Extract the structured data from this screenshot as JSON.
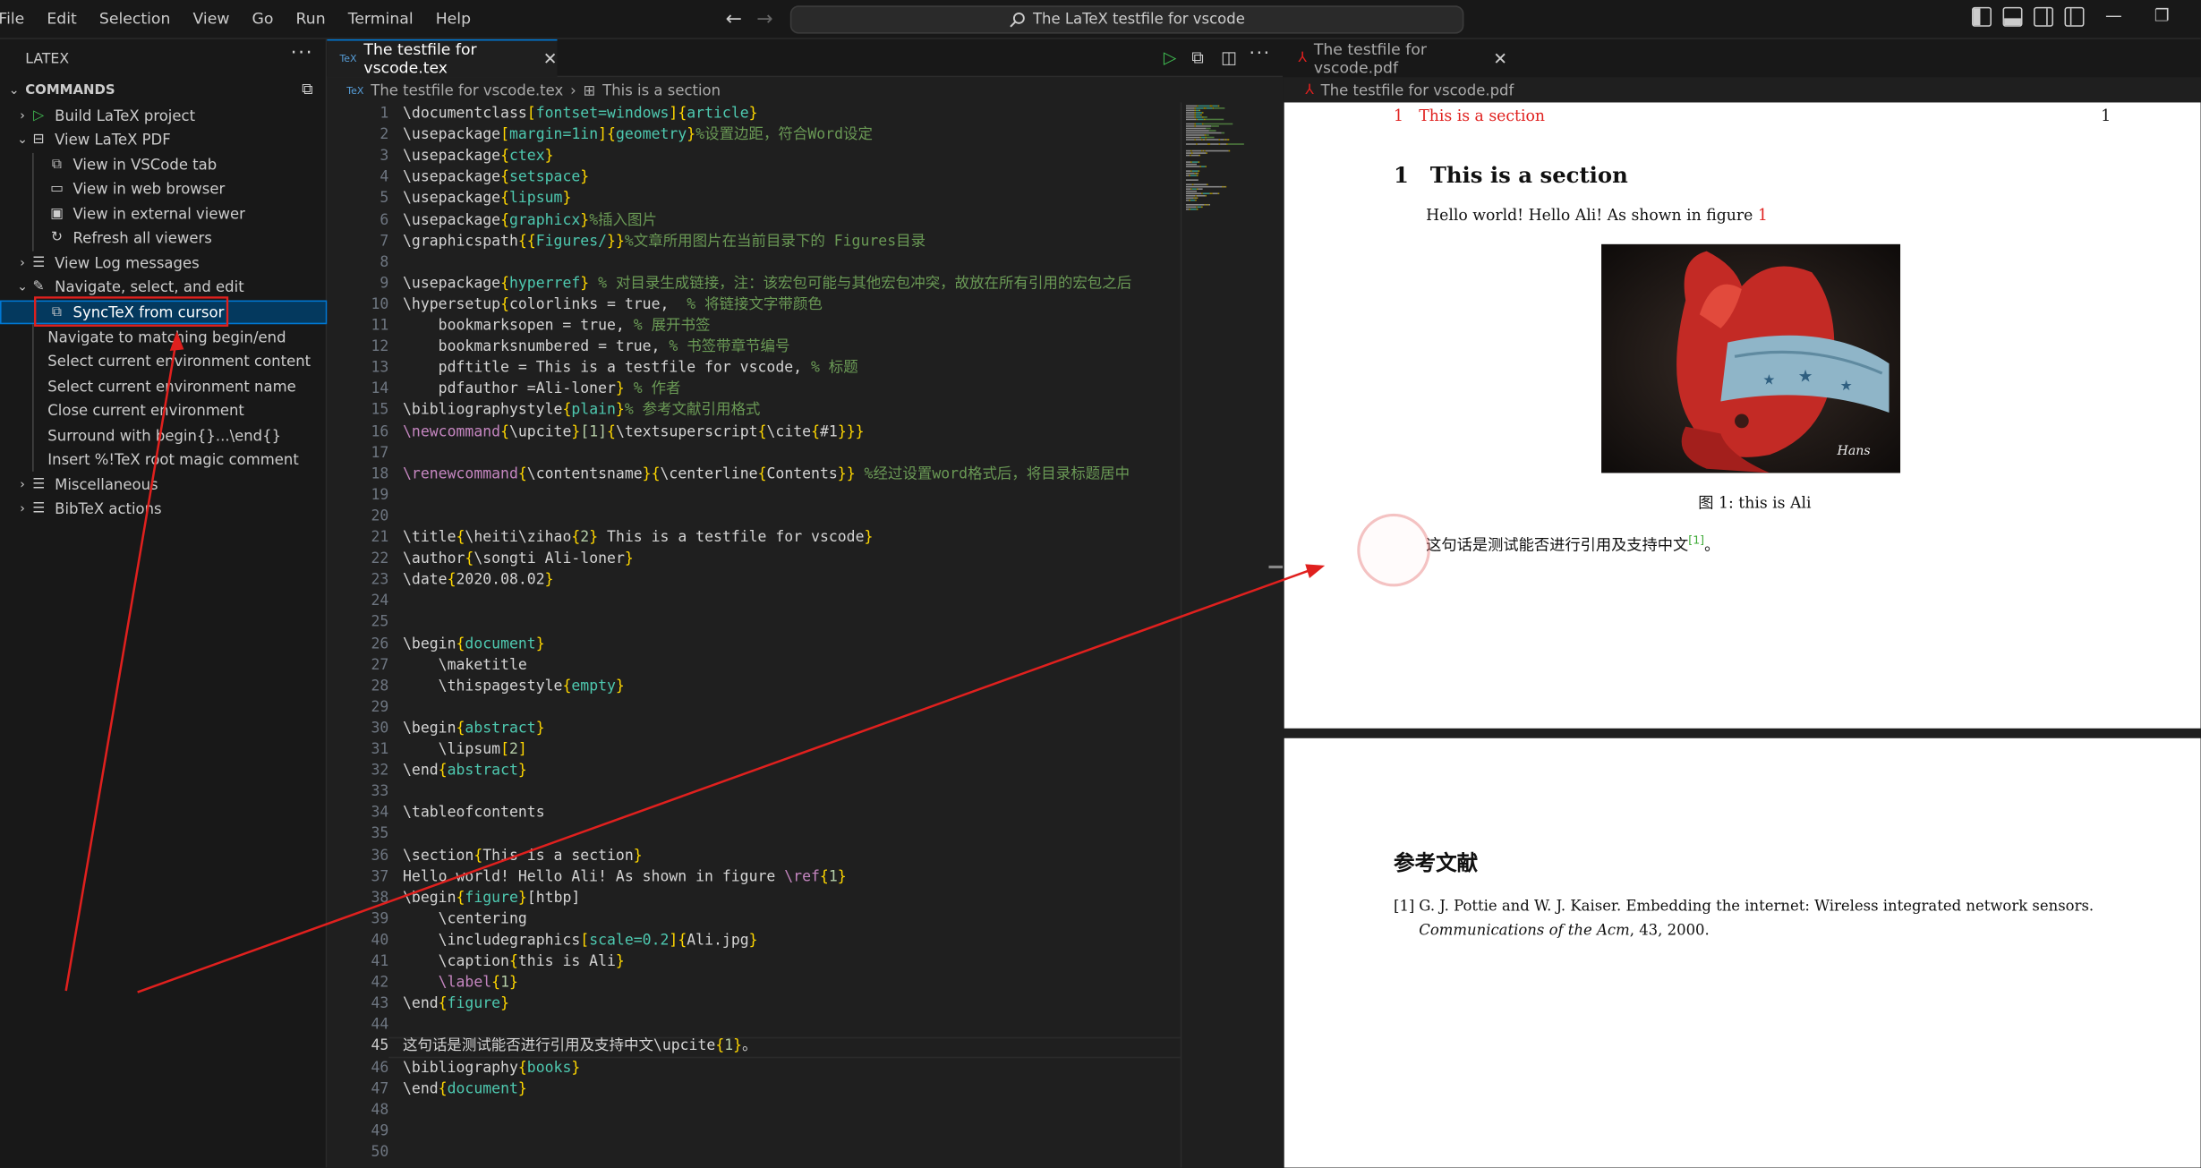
{
  "menubar": {
    "items": [
      "File",
      "Edit",
      "Selection",
      "View",
      "Go",
      "Run",
      "Terminal",
      "Help"
    ]
  },
  "command_center": {
    "label": "The LaTeX testfile for vscode"
  },
  "sidebar": {
    "title": "LATEX",
    "section": "COMMANDS",
    "items": [
      {
        "label": "Build LaTeX project",
        "icon": "play-icon"
      },
      {
        "label": "View LaTeX PDF",
        "icon": "preview-icon"
      },
      {
        "label": "View in VSCode tab",
        "icon": "open-preview-icon"
      },
      {
        "label": "View in web browser",
        "icon": "browser-icon"
      },
      {
        "label": "View in external viewer",
        "icon": "external-icon"
      },
      {
        "label": "Refresh all viewers",
        "icon": "refresh-icon"
      },
      {
        "label": "View Log messages",
        "icon": "output-icon"
      },
      {
        "label": "Navigate, select, and edit",
        "icon": "edit-icon"
      },
      {
        "label": "SyncTeX from cursor",
        "icon": "sync-icon"
      },
      {
        "label": "Navigate to matching begin/end"
      },
      {
        "label": "Select current environment content"
      },
      {
        "label": "Select current environment name"
      },
      {
        "label": "Close current environment"
      },
      {
        "label": "Surround with begin{}...\\end{}"
      },
      {
        "label": "Insert %!TeX root magic comment"
      },
      {
        "label": "Miscellaneous",
        "icon": "list-icon"
      },
      {
        "label": "BibTeX actions",
        "icon": "list-icon"
      }
    ]
  },
  "editor": {
    "tab": "The testfile for vscode.tex",
    "tab_prefix": "TeX",
    "breadcrumb_file": "The testfile for vscode.tex",
    "breadcrumb_symbol": "This is a section",
    "current_line": 45,
    "lines": [
      [
        [
          "\\documentclass",
          "kw"
        ],
        [
          "[",
          "br"
        ],
        [
          "fontset=windows",
          "ar"
        ],
        [
          "]",
          "br"
        ],
        [
          "{",
          "br"
        ],
        [
          "article",
          "ar"
        ],
        [
          "}",
          "br"
        ]
      ],
      [
        [
          "\\usepackage",
          "kw"
        ],
        [
          "[",
          "br"
        ],
        [
          "margin=1in",
          "ar"
        ],
        [
          "]",
          "br"
        ],
        [
          "{",
          "br"
        ],
        [
          "geometry",
          "ar"
        ],
        [
          "}",
          "br"
        ],
        [
          "%设置边距，符合Word设定",
          "cm"
        ]
      ],
      [
        [
          "\\usepackage",
          "kw"
        ],
        [
          "{",
          "br"
        ],
        [
          "ctex",
          "ar"
        ],
        [
          "}",
          "br"
        ]
      ],
      [
        [
          "\\usepackage",
          "kw"
        ],
        [
          "{",
          "br"
        ],
        [
          "setspace",
          "ar"
        ],
        [
          "}",
          "br"
        ]
      ],
      [
        [
          "\\usepackage",
          "kw"
        ],
        [
          "{",
          "br"
        ],
        [
          "lipsum",
          "ar"
        ],
        [
          "}",
          "br"
        ]
      ],
      [
        [
          "\\usepackage",
          "kw"
        ],
        [
          "{",
          "br"
        ],
        [
          "graphicx",
          "ar"
        ],
        [
          "}",
          "br"
        ],
        [
          "%插入图片",
          "cm"
        ]
      ],
      [
        [
          "\\graphicspath",
          "kw"
        ],
        [
          "{{",
          "br"
        ],
        [
          "Figures/",
          "ar"
        ],
        [
          "}}",
          "br"
        ],
        [
          "%文章所用图片在当前目录下的 Figures目录",
          "cm"
        ]
      ],
      [],
      [
        [
          "\\usepackage",
          "kw"
        ],
        [
          "{",
          "br"
        ],
        [
          "hyperref",
          "ar"
        ],
        [
          "}",
          "br"
        ],
        [
          " % 对目录生成链接，注：该宏包可能与其他宏包冲突，故放在所有引用的宏包之后",
          "cm"
        ]
      ],
      [
        [
          "\\hypersetup",
          "kw"
        ],
        [
          "{",
          "br"
        ],
        [
          "colorlinks = true,  ",
          "kw"
        ],
        [
          "% 将链接文字带颜色",
          "cm"
        ]
      ],
      [
        [
          "    bookmarksopen = true, ",
          "kw"
        ],
        [
          "% 展开书签",
          "cm"
        ]
      ],
      [
        [
          "    bookmarksnumbered = true, ",
          "kw"
        ],
        [
          "% 书签带章节编号",
          "cm"
        ]
      ],
      [
        [
          "    pdftitle = This is a testfile for vscode, ",
          "kw"
        ],
        [
          "% 标题",
          "cm"
        ]
      ],
      [
        [
          "    pdfauthor =Ali-loner",
          "kw"
        ],
        [
          "} ",
          "br"
        ],
        [
          "% 作者",
          "cm"
        ]
      ],
      [
        [
          "\\bibliographystyle",
          "kw"
        ],
        [
          "{",
          "br"
        ],
        [
          "plain",
          "ar"
        ],
        [
          "}",
          "br"
        ],
        [
          "% 参考文献引用格式",
          "cm"
        ]
      ],
      [
        [
          "\\newcommand",
          "fn"
        ],
        [
          "{",
          "br"
        ],
        [
          "\\upcite",
          "kw"
        ],
        [
          "}",
          "br"
        ],
        [
          "[1]",
          "nm"
        ],
        [
          "{",
          "br"
        ],
        [
          "\\textsuperscript",
          "kw"
        ],
        [
          "{",
          "br"
        ],
        [
          "\\cite",
          "kw"
        ],
        [
          "{",
          "br"
        ],
        [
          "#1",
          "kw"
        ],
        [
          "}}}",
          "br"
        ]
      ],
      [],
      [
        [
          "\\renewcommand",
          "fn"
        ],
        [
          "{",
          "br"
        ],
        [
          "\\contentsname",
          "kw"
        ],
        [
          "}",
          "br"
        ],
        [
          "{",
          "br"
        ],
        [
          "\\centerline",
          "kw"
        ],
        [
          "{",
          "br"
        ],
        [
          "Contents",
          "kw"
        ],
        [
          "}}",
          "br"
        ],
        [
          " %经过设置word格式后，将目录标题居中",
          "cm"
        ]
      ],
      [],
      [],
      [
        [
          "\\title",
          "kw"
        ],
        [
          "{",
          "br"
        ],
        [
          "\\heiti\\zihao",
          "kw"
        ],
        [
          "{",
          "br"
        ],
        [
          "2",
          "nm"
        ],
        [
          "}",
          "br"
        ],
        [
          " This is a testfile for vscode",
          "kw"
        ],
        [
          "}",
          "br"
        ]
      ],
      [
        [
          "\\author",
          "kw"
        ],
        [
          "{",
          "br"
        ],
        [
          "\\songti Ali-loner",
          "kw"
        ],
        [
          "}",
          "br"
        ]
      ],
      [
        [
          "\\date",
          "kw"
        ],
        [
          "{",
          "br"
        ],
        [
          "2020.08.02",
          "kw"
        ],
        [
          "}",
          "br"
        ]
      ],
      [],
      [],
      [
        [
          "\\begin",
          "kw"
        ],
        [
          "{",
          "br"
        ],
        [
          "document",
          "ar"
        ],
        [
          "}",
          "br"
        ]
      ],
      [
        [
          "    \\maketitle",
          "kw"
        ]
      ],
      [
        [
          "    \\thispagestyle",
          "kw"
        ],
        [
          "{",
          "br"
        ],
        [
          "empty",
          "ar"
        ],
        [
          "}",
          "br"
        ]
      ],
      [],
      [
        [
          "\\begin",
          "kw"
        ],
        [
          "{",
          "br"
        ],
        [
          "abstract",
          "ar"
        ],
        [
          "}",
          "br"
        ]
      ],
      [
        [
          "    \\lipsum",
          "kw"
        ],
        [
          "[",
          "br"
        ],
        [
          "2",
          "nm"
        ],
        [
          "]",
          "br"
        ]
      ],
      [
        [
          "\\end",
          "kw"
        ],
        [
          "{",
          "br"
        ],
        [
          "abstract",
          "ar"
        ],
        [
          "}",
          "br"
        ]
      ],
      [],
      [
        [
          "\\tableofcontents",
          "kw"
        ]
      ],
      [],
      [
        [
          "\\section",
          "kw"
        ],
        [
          "{",
          "br"
        ],
        [
          "This is a section",
          "kw"
        ],
        [
          "}",
          "br"
        ]
      ],
      [
        [
          "Hello world! Hello Ali! As shown in figure ",
          "kw"
        ],
        [
          "\\ref",
          "fn"
        ],
        [
          "{",
          "br"
        ],
        [
          "1",
          "nm"
        ],
        [
          "}",
          "br"
        ]
      ],
      [
        [
          "\\begin",
          "kw"
        ],
        [
          "{",
          "br"
        ],
        [
          "figure",
          "ar"
        ],
        [
          "}",
          "br"
        ],
        [
          "[htbp]",
          "kw"
        ]
      ],
      [
        [
          "    \\centering",
          "kw"
        ]
      ],
      [
        [
          "    \\includegraphics",
          "kw"
        ],
        [
          "[",
          "br"
        ],
        [
          "scale=0.2",
          "ar"
        ],
        [
          "]",
          "br"
        ],
        [
          "{",
          "br"
        ],
        [
          "Ali.jpg",
          "kw"
        ],
        [
          "}",
          "br"
        ]
      ],
      [
        [
          "    \\caption",
          "kw"
        ],
        [
          "{",
          "br"
        ],
        [
          "this is Ali",
          "kw"
        ],
        [
          "}",
          "br"
        ]
      ],
      [
        [
          "    \\label",
          "fn"
        ],
        [
          "{",
          "br"
        ],
        [
          "1",
          "nm"
        ],
        [
          "}",
          "br"
        ]
      ],
      [
        [
          "\\end",
          "kw"
        ],
        [
          "{",
          "br"
        ],
        [
          "figure",
          "ar"
        ],
        [
          "}",
          "br"
        ]
      ],
      [],
      [
        [
          "这句话是测试能否进行引用及支持中文",
          "kw"
        ],
        [
          "\\upcite",
          "kw"
        ],
        [
          "{",
          "br"
        ],
        [
          "1",
          "nm"
        ],
        [
          "}",
          "br"
        ],
        [
          "。",
          "kw"
        ]
      ],
      [
        [
          "\\bibliography",
          "kw"
        ],
        [
          "{",
          "br"
        ],
        [
          "books",
          "ar"
        ],
        [
          "}",
          "br"
        ]
      ],
      [
        [
          "\\end",
          "kw"
        ],
        [
          "{",
          "br"
        ],
        [
          "document",
          "ar"
        ],
        [
          "}",
          "br"
        ]
      ],
      [],
      [],
      []
    ]
  },
  "pdf": {
    "tab": "The testfile for vscode.pdf",
    "breadcrumb": "The testfile for vscode.pdf",
    "page1": {
      "header_num": "1",
      "header_title": "This is a section",
      "page_number": "1",
      "section_num": "1",
      "section_title": "This is a section",
      "paragraph": "Hello world! Hello Ali! As shown in figure",
      "fig_ref": "1",
      "figure_caption": "图 1: this is Ali",
      "signature": "Hans",
      "cn_sentence": "这句话是测试能否进行引用及支持中文",
      "cite": "[1]",
      "cn_end": "。"
    },
    "page2": {
      "heading": "参考文献",
      "ref_num": "[1]",
      "ref_text": "G. J. Pottie and W. J. Kaiser.  Embedding the internet:  Wireless integrated network sensors.",
      "ref_journal": "Communications of the Acm",
      "ref_tail": ", 43, 2000."
    }
  },
  "colors": {
    "accent": "#0078d4",
    "annotation_red": "#e0201e",
    "selection": "#04395e"
  }
}
